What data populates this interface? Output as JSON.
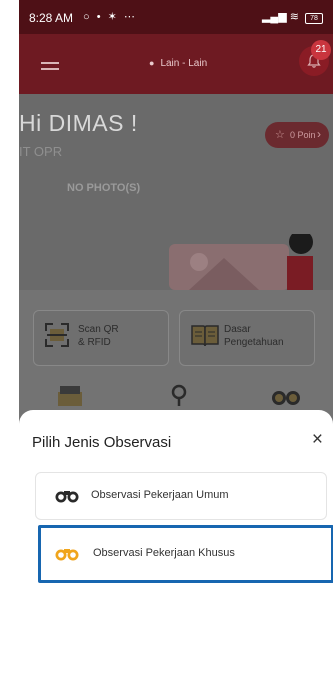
{
  "status_bar": {
    "time": "8:28 AM",
    "notification_icons": "○ • ✶ ⋯",
    "battery": "78"
  },
  "header": {
    "location": "Lain - Lain",
    "notification_count": "21"
  },
  "greeting": {
    "hello": "Hi DIMAS !",
    "role": "IT OPR",
    "poin": "0 Poin",
    "photo_placeholder": "NO PHOTO(S)"
  },
  "features": [
    {
      "label_line1": "Scan QR",
      "label_line2": "& RFID"
    },
    {
      "label_line1": "Dasar",
      "label_line2": "Pengetahuan"
    }
  ],
  "sheet": {
    "title": "Pilih Jenis Observasi",
    "close": "×",
    "options": [
      {
        "label": "Observasi Pekerjaan Umum"
      },
      {
        "label": "Observasi Pekerjaan Khusus"
      }
    ]
  },
  "colors": {
    "brand": "#6e1a22",
    "overlay": "#7c7c7c",
    "highlight": "#1766b0",
    "khusus_icon": "#f0a51c"
  }
}
